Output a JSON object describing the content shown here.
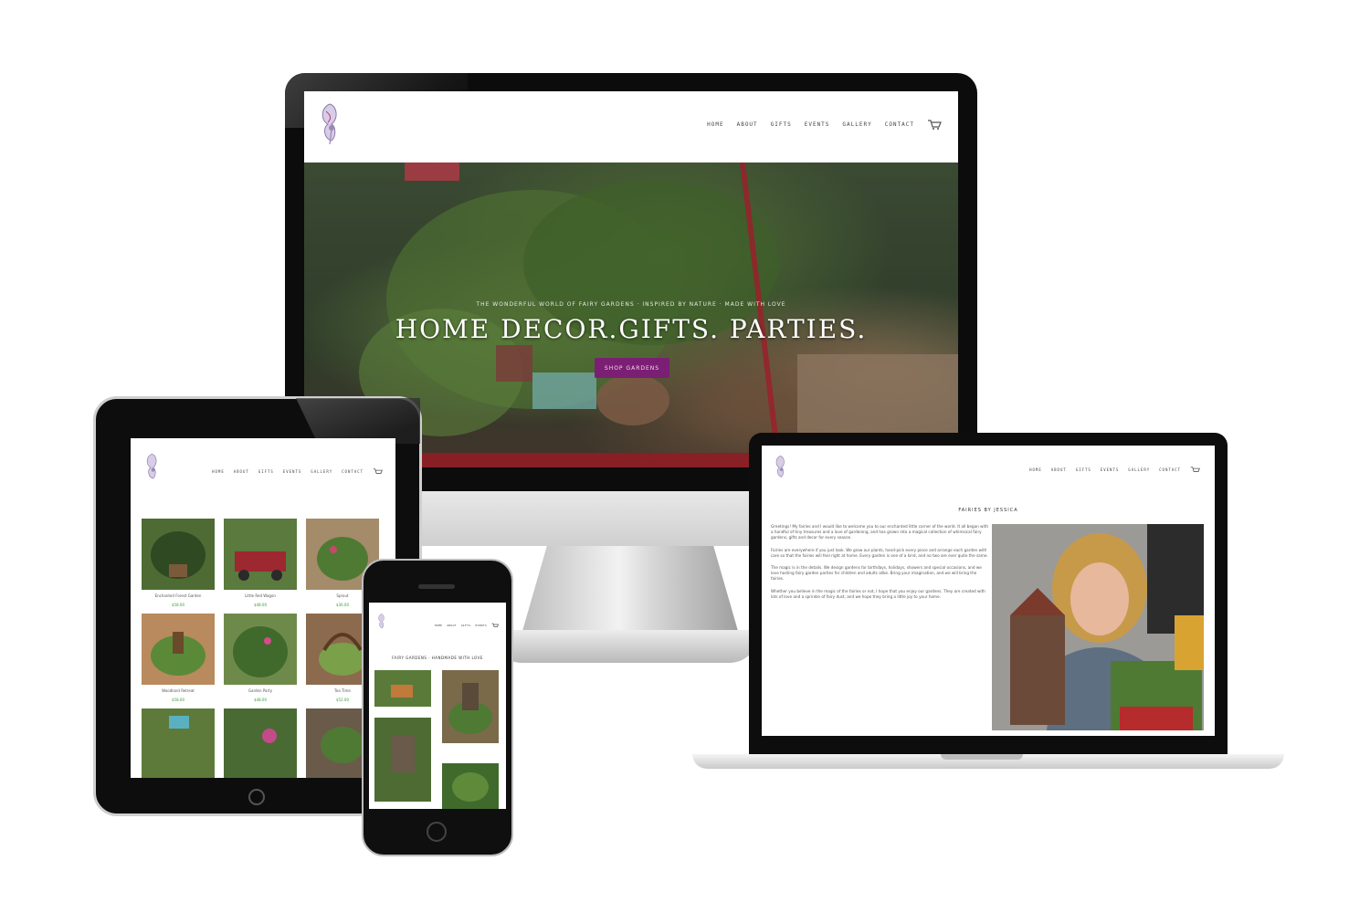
{
  "nav": {
    "items": [
      "HOME",
      "ABOUT",
      "GIFTS",
      "EVENTS",
      "GALLERY",
      "CONTACT"
    ]
  },
  "hero": {
    "tagline": "THE WONDERFUL WORLD OF FAIRY GARDENS · INSPIRED BY NATURE · MADE WITH LOVE",
    "title": "HOME DECOR.GIFTS. PARTIES.",
    "cta": "SHOP GARDENS"
  },
  "tablet": {
    "products": [
      {
        "name": "Enchanted Forest Garden",
        "price": "$58.00"
      },
      {
        "name": "Little Red Wagon",
        "price": "$48.00"
      },
      {
        "name": "Sprout",
        "price": "$36.00"
      },
      {
        "name": "Woodland Retreat",
        "price": "$58.00"
      },
      {
        "name": "Garden Party",
        "price": "$48.00"
      },
      {
        "name": "Tea Time",
        "price": "$52.00"
      }
    ]
  },
  "phone": {
    "heading": "FAIRY GARDENS · HANDMADE WITH LOVE"
  },
  "laptop": {
    "heading": "FAIRIES BY JESSICA",
    "paragraphs": [
      "Greetings! My fairies and I would like to welcome you to our enchanted little corner of the world. It all began with a handful of tiny treasures and a love of gardening, and has grown into a magical collection of whimsical fairy gardens, gifts and decor for every season.",
      "Fairies are everywhere if you just look. We grow our plants, hand-pick every piece and arrange each garden with care so that the fairies will feel right at home. Every garden is one of a kind, and no two are ever quite the same.",
      "The magic is in the details. We design gardens for birthdays, holidays, showers and special occasions, and we love hosting fairy garden parties for children and adults alike. Bring your imagination, and we will bring the fairies.",
      "Whether you believe in the magic of the fairies or not, I hope that you enjoy our gardens. They are created with lots of love and a sprinkle of fairy dust, and we hope they bring a little joy to your home."
    ]
  },
  "colors": {
    "accent": "#7b1f74",
    "price": "#3c9a3c",
    "bezel": "#0c0c0c"
  },
  "icons": [
    "fairy-logo-icon",
    "cart-icon",
    "home-button-icon"
  ]
}
